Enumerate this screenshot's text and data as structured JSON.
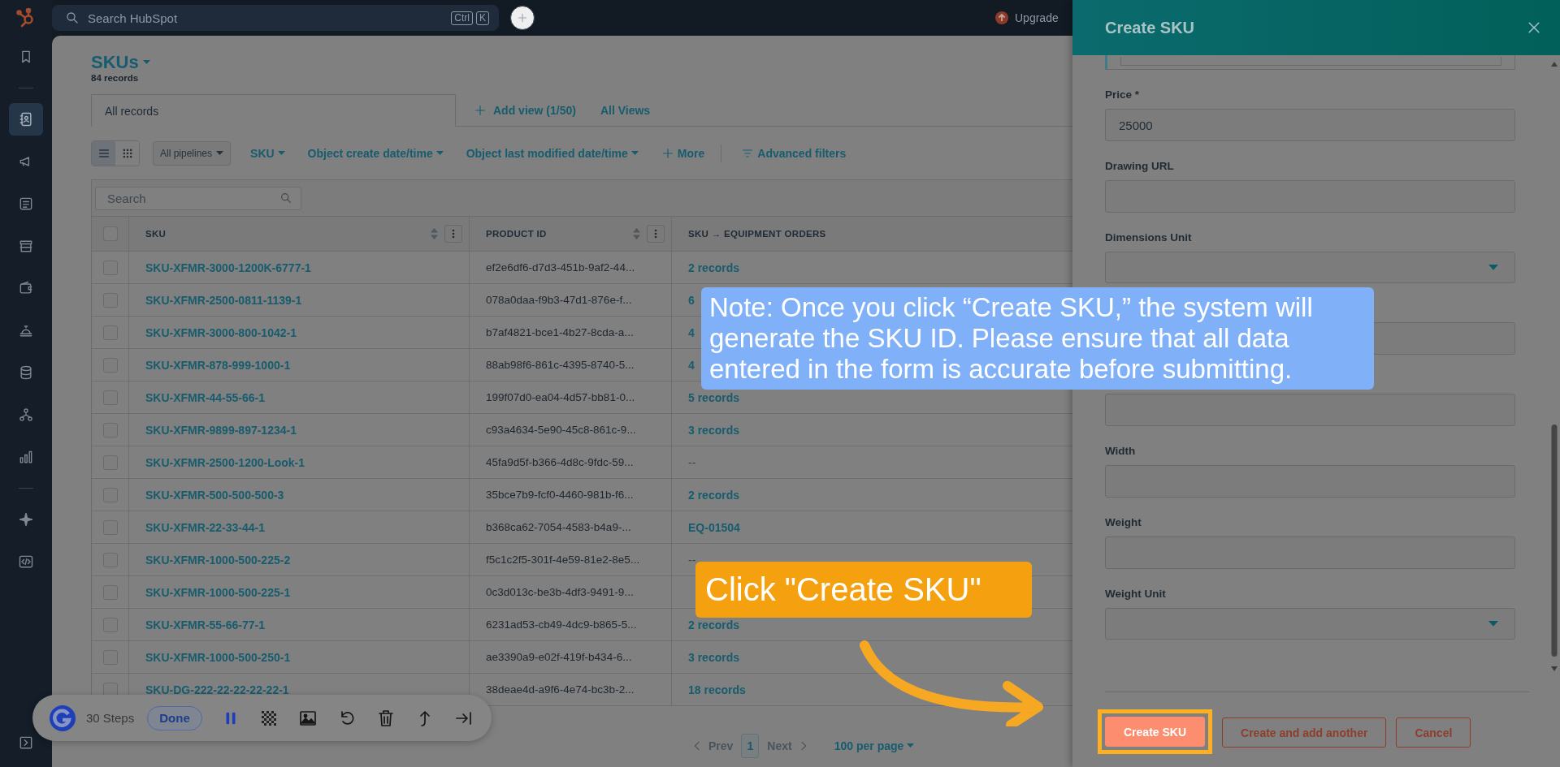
{
  "topbar": {
    "search": {
      "placeholder": "Search HubSpot",
      "shortcut": [
        "Ctrl",
        "K"
      ]
    },
    "upgrade": "Upgrade"
  },
  "sidebar": {
    "items": [
      {
        "selected": false
      },
      {
        "selected": true
      },
      {
        "selected": false
      },
      {
        "selected": false
      },
      {
        "selected": false
      },
      {
        "selected": false
      },
      {
        "selected": false
      },
      {
        "selected": false
      },
      {
        "selected": false
      },
      {
        "selected": false
      },
      {
        "selected": false
      },
      {
        "selected": false
      }
    ]
  },
  "page": {
    "title": "SKUs",
    "record_count": "84 records"
  },
  "views": {
    "tabs": [
      {
        "label": "All records",
        "selected": true
      }
    ],
    "add_view": "Add view (1/50)",
    "all_views": "All Views"
  },
  "filters": {
    "view_modes": [
      {
        "selected": true
      },
      {
        "selected": false
      }
    ],
    "pipeline": "All pipelines",
    "items": [
      "SKU",
      "Object create date/time",
      "Object last modified date/time"
    ],
    "more": "More",
    "advanced": "Advanced filters"
  },
  "table": {
    "search": {
      "placeholder": "Search"
    },
    "select_all": {
      "checked": false
    },
    "columns": [
      "SKU",
      "PRODUCT ID",
      "SKU → EQUIPMENT ORDERS"
    ],
    "rows": [
      {
        "checked": false,
        "sku": "SKU-XFMR-3000-1200K-6777-1",
        "product_id": "ef2e6df6-d7d3-451b-9af2-44...",
        "orders": "2 records"
      },
      {
        "checked": false,
        "sku": "SKU-XFMR-2500-0811-1139-1",
        "product_id": "078a0daa-f9b3-47d1-876e-f...",
        "orders": "6"
      },
      {
        "checked": false,
        "sku": "SKU-XFMR-3000-800-1042-1",
        "product_id": "b7af4821-bce1-4b27-8cda-a...",
        "orders": "4"
      },
      {
        "checked": false,
        "sku": "SKU-XFMR-878-999-1000-1",
        "product_id": "88ab98f6-861c-4395-8740-5...",
        "orders": "4"
      },
      {
        "checked": false,
        "sku": "SKU-XFMR-44-55-66-1",
        "product_id": "199f07d0-ea04-4d57-bb81-0...",
        "orders": "5 records"
      },
      {
        "checked": false,
        "sku": "SKU-XFMR-9899-897-1234-1",
        "product_id": "c93a4634-5e90-45c8-861c-9...",
        "orders": "3 records"
      },
      {
        "checked": false,
        "sku": "SKU-XFMR-2500-1200-Look-1",
        "product_id": "45fa9d5f-b366-4d8c-9fdc-59...",
        "orders": "--"
      },
      {
        "checked": false,
        "sku": "SKU-XFMR-500-500-500-3",
        "product_id": "35bce7b9-fcf0-4460-981b-f6...",
        "orders": "2 records"
      },
      {
        "checked": false,
        "sku": "SKU-XFMR-22-33-44-1",
        "product_id": "b368ca62-7054-4583-b4a9-...",
        "orders": "EQ-01504"
      },
      {
        "checked": false,
        "sku": "SKU-XFMR-1000-500-225-2",
        "product_id": "f5c1c2f5-301f-4e59-81e2-8e5...",
        "orders": "--"
      },
      {
        "checked": false,
        "sku": "SKU-XFMR-1000-500-225-1",
        "product_id": "0c3d013c-be3b-4df3-9491-9..."
      },
      {
        "checked": false,
        "sku": "SKU-XFMR-55-66-77-1",
        "product_id": "6231ad53-cb49-4dc9-b865-5...",
        "orders": "2 records"
      },
      {
        "checked": false,
        "sku": "SKU-XFMR-1000-500-250-1",
        "product_id": "ae3390a9-e02f-419f-b434-6...",
        "orders": "3 records"
      },
      {
        "checked": false,
        "sku": "SKU-DG-222-22-22-22-22-1",
        "product_id": "38deae4d-a9f6-4e74-bc3b-2...",
        "orders": "18 records"
      }
    ]
  },
  "pagination": {
    "prev": "Prev",
    "page": "1",
    "next": "Next",
    "per_page": "100 per page"
  },
  "panel": {
    "title": "Create SKU",
    "fields": [
      {
        "label": "Price *",
        "kind": "text",
        "value": "25000"
      },
      {
        "label": "Drawing URL",
        "kind": "text"
      },
      {
        "label": "Dimensions Unit",
        "kind": "select"
      },
      {
        "kind": "text"
      },
      {
        "kind": "text"
      },
      {
        "label": "Width",
        "kind": "text"
      },
      {
        "label": "Weight",
        "kind": "text"
      },
      {
        "label": "Weight Unit",
        "kind": "select"
      }
    ],
    "buttons": [
      {
        "label": "Create SKU",
        "kind": "primary",
        "highlighted": true
      },
      {
        "label": "Create and add another",
        "kind": "secondary",
        "highlighted": false
      },
      {
        "label": "Cancel",
        "kind": "secondary",
        "highlighted": false
      }
    ]
  },
  "guide_toolbar": {
    "steps": "30 Steps",
    "done": "Done"
  },
  "callouts": {
    "note": "Note: Once you click “Create SKU,” the system will generate the SKU ID. Please ensure that all data entered in the form is accurate before submitting.",
    "step": "Click \"Create SKU\""
  }
}
